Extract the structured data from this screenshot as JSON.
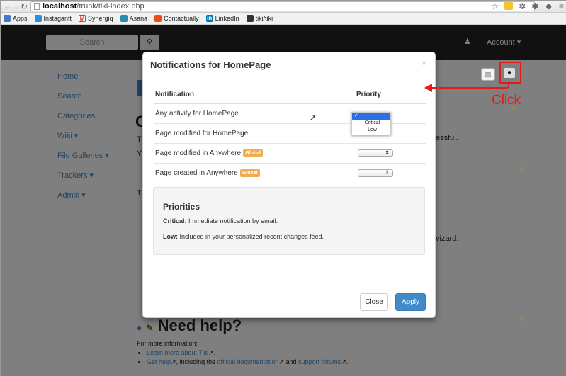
{
  "browser": {
    "url_host": "localhost",
    "url_path": "/trunk/tiki-index.php",
    "bookmarks": [
      {
        "label": "Apps",
        "icon": "apps-grid-icon",
        "color": "#4a76c4"
      },
      {
        "label": "Instagantt",
        "icon": "instagantt-icon",
        "color": "#2e8fd9"
      },
      {
        "label": "Synergiq",
        "icon": "gmail-icon",
        "color": "#d33"
      },
      {
        "label": "Asana",
        "icon": "asana-icon",
        "color": "#2a8bb0"
      },
      {
        "label": "Contactually",
        "icon": "contactually-icon",
        "color": "#e94e1b"
      },
      {
        "label": "LinkedIn",
        "icon": "linkedin-icon",
        "color": "#0077b5"
      },
      {
        "label": "tiki/tiki",
        "icon": "tiki-icon",
        "color": "#333"
      }
    ]
  },
  "topnav": {
    "search_placeholder": "Search",
    "account_label": "Account ▾"
  },
  "sidebar": {
    "items": [
      {
        "label": "Home"
      },
      {
        "label": "Search"
      },
      {
        "label": "Categories"
      },
      {
        "label": "Wiki ▾"
      },
      {
        "label": "File Galleries ▾"
      },
      {
        "label": "Trackers ▾"
      },
      {
        "label": "Admin ▾"
      }
    ]
  },
  "background": {
    "heading_fragment": "C",
    "text_fragments": [
      "T",
      "Y",
      "T"
    ],
    "right_fragment_1": "essful.",
    "right_fragment_2": "vizard.",
    "help_title": "Need help?",
    "help_intro": "For more information:",
    "help_item_1_link": "Learn more about Tiki",
    "help_item_2_link": "Get help",
    "help_item_2_mid": ", including the ",
    "help_item_2_link2": "official documentation",
    "help_item_2_and": " and ",
    "help_item_2_link3": "support forums",
    "help_item_2_end": "."
  },
  "modal": {
    "title": "Notifications for HomePage",
    "close_glyph": "×",
    "col_notification": "Notification",
    "col_priority": "Priority",
    "rows": [
      {
        "label": "Any activity for HomePage",
        "global": ""
      },
      {
        "label": "Page modified for HomePage",
        "global": ""
      },
      {
        "label": "Page modified in Anywhere",
        "global": "Global"
      },
      {
        "label": "Page created in Anywhere",
        "global": "Global"
      }
    ],
    "dropdown_options": [
      "✓",
      "Critical",
      "Low"
    ],
    "priorities_title": "Priorities",
    "critical_label": "Critical:",
    "critical_text": " Immediate notification by email.",
    "low_label": "Low:",
    "low_text": " Included in your personalized recent changes feed.",
    "close_button": "Close",
    "apply_button": "Apply"
  },
  "annotation": {
    "text": "Click",
    "color": "#e31b1b"
  }
}
